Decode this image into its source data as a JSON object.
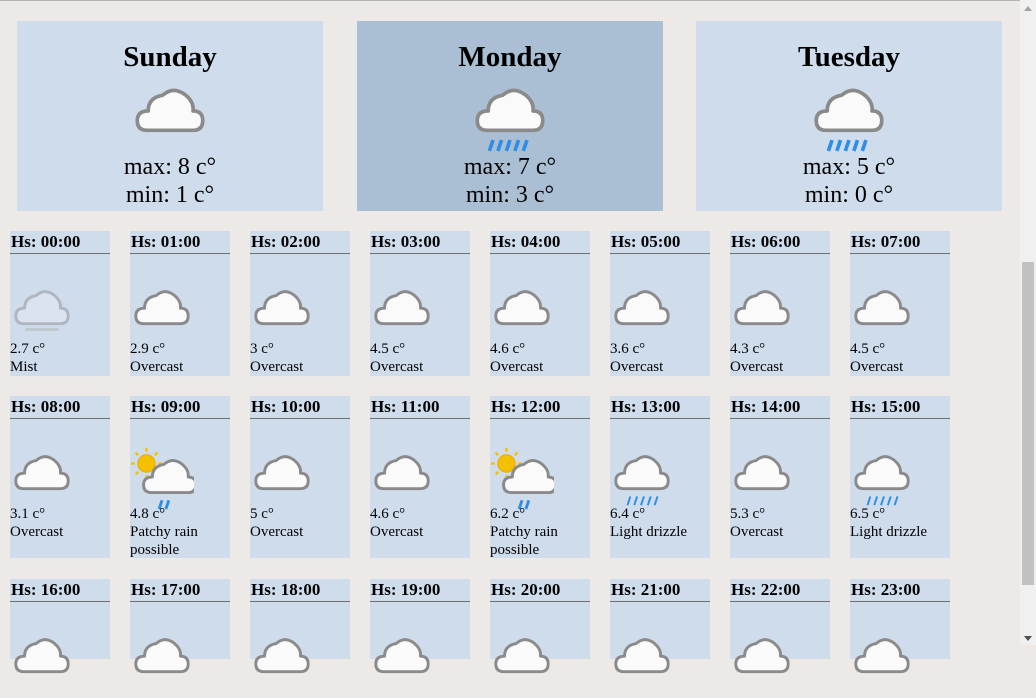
{
  "days": [
    {
      "name": "Sunday",
      "max": "max: 8 c°",
      "min": "min: 1 c°",
      "icon": "cloud-icon",
      "selected": false
    },
    {
      "name": "Monday",
      "max": "max: 7 c°",
      "min": "min: 3 c°",
      "icon": "cloud-rain-icon",
      "selected": true
    },
    {
      "name": "Tuesday",
      "max": "max: 5 c°",
      "min": "min: 0 c°",
      "icon": "cloud-rain-icon",
      "selected": false
    }
  ],
  "hours": [
    {
      "time": "Hs: 00:00",
      "temp": "2.7 c°",
      "cond": "Mist",
      "icon": "mist-icon"
    },
    {
      "time": "Hs: 01:00",
      "temp": "2.9 c°",
      "cond": "Overcast",
      "icon": "cloud-icon"
    },
    {
      "time": "Hs: 02:00",
      "temp": "3 c°",
      "cond": "Overcast",
      "icon": "cloud-icon"
    },
    {
      "time": "Hs: 03:00",
      "temp": "4.5 c°",
      "cond": "Overcast",
      "icon": "cloud-icon"
    },
    {
      "time": "Hs: 04:00",
      "temp": "4.6 c°",
      "cond": "Overcast",
      "icon": "cloud-icon"
    },
    {
      "time": "Hs: 05:00",
      "temp": "3.6 c°",
      "cond": "Overcast",
      "icon": "cloud-icon"
    },
    {
      "time": "Hs: 06:00",
      "temp": "4.3 c°",
      "cond": "Overcast",
      "icon": "cloud-icon"
    },
    {
      "time": "Hs: 07:00",
      "temp": "4.5 c°",
      "cond": "Overcast",
      "icon": "cloud-icon"
    },
    {
      "time": "Hs: 08:00",
      "temp": "3.1 c°",
      "cond": "Overcast",
      "icon": "cloud-icon"
    },
    {
      "time": "Hs: 09:00",
      "temp": "4.8 c°",
      "cond": "Patchy rain possible",
      "icon": "sun-cloud-rain-icon"
    },
    {
      "time": "Hs: 10:00",
      "temp": "5 c°",
      "cond": "Overcast",
      "icon": "cloud-icon"
    },
    {
      "time": "Hs: 11:00",
      "temp": "4.6 c°",
      "cond": "Overcast",
      "icon": "cloud-icon"
    },
    {
      "time": "Hs: 12:00",
      "temp": "6.2 c°",
      "cond": "Patchy rain possible",
      "icon": "sun-cloud-rain-icon"
    },
    {
      "time": "Hs: 13:00",
      "temp": "6.4 c°",
      "cond": "Light drizzle",
      "icon": "drizzle-icon"
    },
    {
      "time": "Hs: 14:00",
      "temp": "5.3 c°",
      "cond": "Overcast",
      "icon": "cloud-icon"
    },
    {
      "time": "Hs: 15:00",
      "temp": "6.5 c°",
      "cond": "Light drizzle",
      "icon": "drizzle-icon"
    },
    {
      "time": "Hs: 16:00",
      "temp": "",
      "cond": "",
      "icon": "cloud-icon"
    },
    {
      "time": "Hs: 17:00",
      "temp": "",
      "cond": "",
      "icon": "cloud-icon"
    },
    {
      "time": "Hs: 18:00",
      "temp": "",
      "cond": "",
      "icon": "cloud-icon"
    },
    {
      "time": "Hs: 19:00",
      "temp": "",
      "cond": "",
      "icon": "cloud-icon"
    },
    {
      "time": "Hs: 20:00",
      "temp": "",
      "cond": "",
      "icon": "cloud-icon"
    },
    {
      "time": "Hs: 21:00",
      "temp": "",
      "cond": "",
      "icon": "cloud-icon"
    },
    {
      "time": "Hs: 22:00",
      "temp": "",
      "cond": "",
      "icon": "cloud-icon"
    },
    {
      "time": "Hs: 23:00",
      "temp": "",
      "cond": "",
      "icon": "cloud-icon"
    }
  ],
  "colors": {
    "card": "#cfdcec",
    "card_selected": "#abbfd4",
    "rain": "#2e8ee6",
    "sun": "#f5c000",
    "cloud_stroke": "#8a8a8a"
  }
}
